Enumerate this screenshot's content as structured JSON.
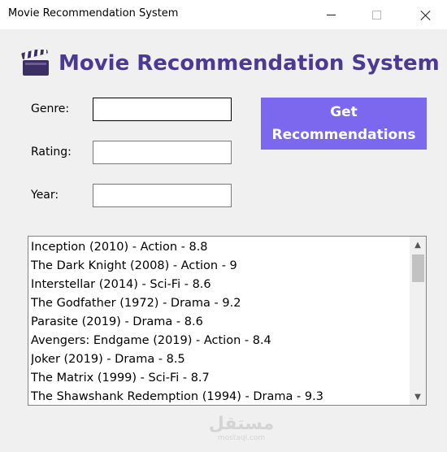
{
  "window": {
    "title": "Movie Recommendation System",
    "controls": {
      "minimize": "minimize",
      "maximize": "maximize",
      "close": "close"
    }
  },
  "heading": {
    "icon": "clapperboard-icon",
    "text": "Movie Recommendation System",
    "color": "#4b3a94"
  },
  "form": {
    "genre": {
      "label": "Genre:",
      "value": ""
    },
    "rating": {
      "label": "Rating:",
      "value": ""
    },
    "year": {
      "label": "Year:",
      "value": ""
    }
  },
  "button": {
    "label": "Get\nRecommendations",
    "color": "#7b68ee"
  },
  "results": {
    "items": [
      "Inception (2010) - Action - 8.8",
      "The Dark Knight (2008) - Action - 9",
      "Interstellar (2014) - Sci-Fi - 8.6",
      "The Godfather (1972) - Drama - 9.2",
      "Parasite (2019) - Drama - 8.6",
      "Avengers: Endgame (2019) - Action - 8.4",
      "Joker (2019) - Drama - 8.5",
      "The Matrix (1999) - Sci-Fi - 8.7",
      "The Shawshank Redemption (1994) - Drama - 9.3"
    ]
  },
  "watermark": {
    "main": "مستقل",
    "sub": "mostaql.com"
  }
}
